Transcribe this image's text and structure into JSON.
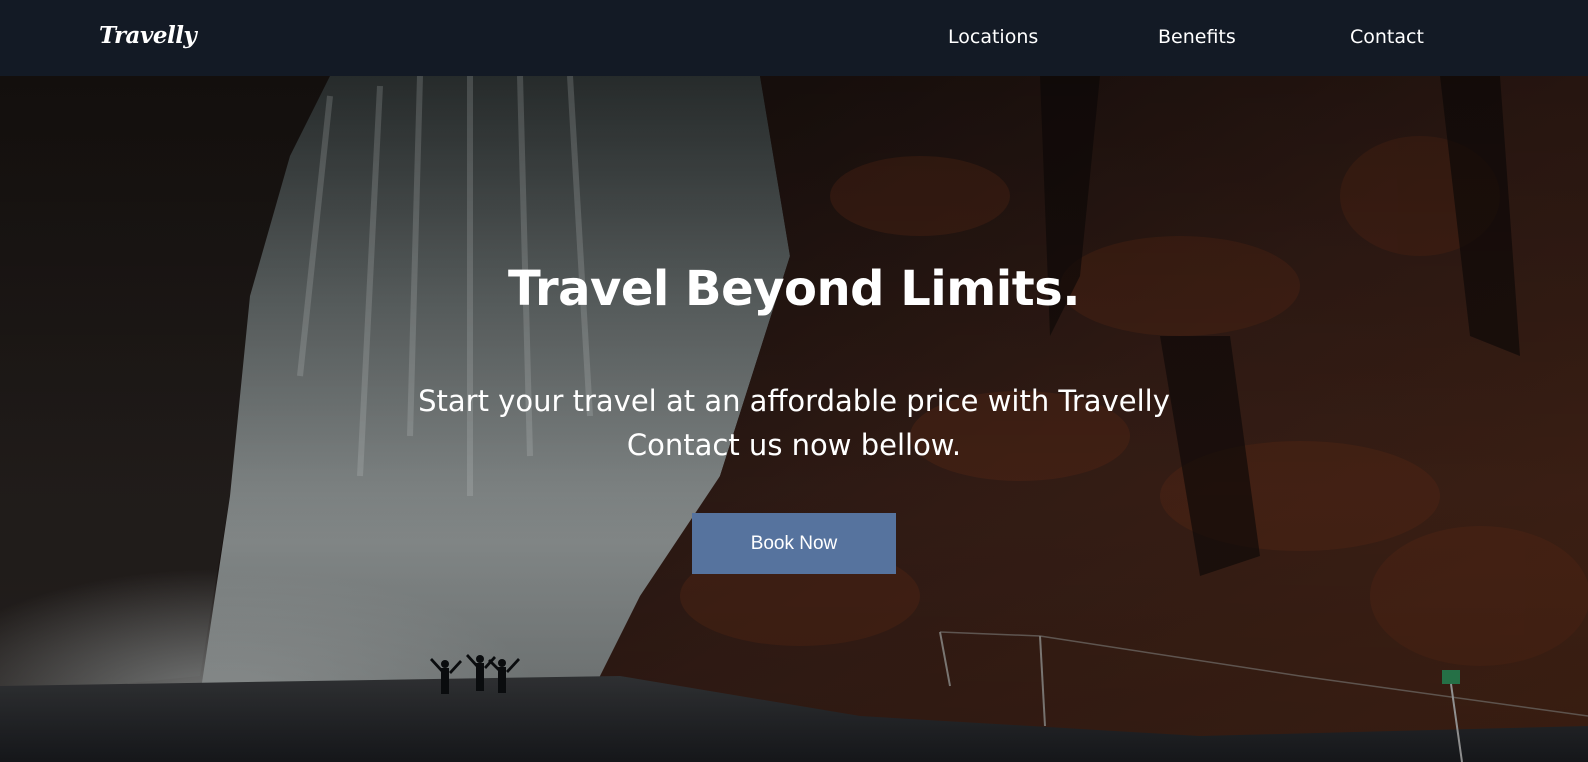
{
  "brand": {
    "logo_text": "Travelly"
  },
  "nav": {
    "items": [
      {
        "label": "Locations"
      },
      {
        "label": "Benefits"
      },
      {
        "label": "Contact"
      }
    ]
  },
  "hero": {
    "title": "Travel Beyond Limits.",
    "subtitle_line1": "Start your travel at an affordable price with Travelly",
    "subtitle_line2": "Contact us now bellow.",
    "cta_label": "Book Now"
  },
  "colors": {
    "navbar_bg": "#131a25",
    "cta_bg": "#56739e",
    "text": "#ffffff"
  }
}
